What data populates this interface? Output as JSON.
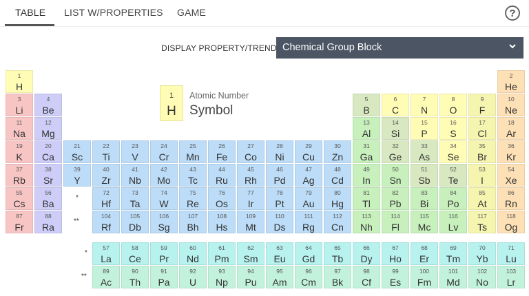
{
  "tabs": [
    {
      "label": "TABLE",
      "active": true
    },
    {
      "label": "LIST W/PROPERTIES",
      "active": false
    },
    {
      "label": "GAME",
      "active": false
    }
  ],
  "help_icon": "question-circle-icon",
  "display": {
    "label": "DISPLAY PROPERTY/TREND",
    "selected": "Chemical Group Block"
  },
  "legend": {
    "number": "1",
    "symbol": "H",
    "number_label": "Atomic Number",
    "symbol_label": "Symbol"
  },
  "markers": {
    "lanthanide": "*",
    "actinide": "**"
  },
  "colors": {
    "nonmetal": "#fffcb5",
    "noble_gas": "#fde0b5",
    "alkali_metal": "#f8c5c5",
    "alkaline_earth": "#cdcdf8",
    "transition_metal": "#bcdcf7",
    "post_transition": "#c7f0bd",
    "metalloid": "#d8e8c0",
    "halogen": "#f5f5b0",
    "lanthanide": "#b7f2ee",
    "actinide": "#c2f2dc"
  },
  "elements": [
    {
      "n": "1",
      "s": "H",
      "g": "nonmetal"
    },
    {
      "n": "2",
      "s": "He",
      "g": "noble_gas"
    },
    {
      "n": "3",
      "s": "Li",
      "g": "alkali_metal"
    },
    {
      "n": "4",
      "s": "Be",
      "g": "alkaline_earth"
    },
    {
      "n": "5",
      "s": "B",
      "g": "metalloid"
    },
    {
      "n": "6",
      "s": "C",
      "g": "nonmetal"
    },
    {
      "n": "7",
      "s": "N",
      "g": "nonmetal"
    },
    {
      "n": "8",
      "s": "O",
      "g": "nonmetal"
    },
    {
      "n": "9",
      "s": "F",
      "g": "halogen"
    },
    {
      "n": "10",
      "s": "Ne",
      "g": "noble_gas"
    },
    {
      "n": "11",
      "s": "Na",
      "g": "alkali_metal"
    },
    {
      "n": "12",
      "s": "Mg",
      "g": "alkaline_earth"
    },
    {
      "n": "13",
      "s": "Al",
      "g": "post_transition"
    },
    {
      "n": "14",
      "s": "Si",
      "g": "metalloid"
    },
    {
      "n": "15",
      "s": "P",
      "g": "nonmetal"
    },
    {
      "n": "16",
      "s": "S",
      "g": "nonmetal"
    },
    {
      "n": "17",
      "s": "Cl",
      "g": "halogen"
    },
    {
      "n": "18",
      "s": "Ar",
      "g": "noble_gas"
    },
    {
      "n": "19",
      "s": "K",
      "g": "alkali_metal"
    },
    {
      "n": "20",
      "s": "Ca",
      "g": "alkaline_earth"
    },
    {
      "n": "21",
      "s": "Sc",
      "g": "transition_metal"
    },
    {
      "n": "22",
      "s": "Ti",
      "g": "transition_metal"
    },
    {
      "n": "23",
      "s": "V",
      "g": "transition_metal"
    },
    {
      "n": "24",
      "s": "Cr",
      "g": "transition_metal"
    },
    {
      "n": "25",
      "s": "Mn",
      "g": "transition_metal"
    },
    {
      "n": "26",
      "s": "Fe",
      "g": "transition_metal"
    },
    {
      "n": "27",
      "s": "Co",
      "g": "transition_metal"
    },
    {
      "n": "28",
      "s": "Ni",
      "g": "transition_metal"
    },
    {
      "n": "29",
      "s": "Cu",
      "g": "transition_metal"
    },
    {
      "n": "30",
      "s": "Zn",
      "g": "transition_metal"
    },
    {
      "n": "31",
      "s": "Ga",
      "g": "post_transition"
    },
    {
      "n": "32",
      "s": "Ge",
      "g": "metalloid"
    },
    {
      "n": "33",
      "s": "As",
      "g": "metalloid"
    },
    {
      "n": "34",
      "s": "Se",
      "g": "nonmetal"
    },
    {
      "n": "35",
      "s": "Br",
      "g": "halogen"
    },
    {
      "n": "36",
      "s": "Kr",
      "g": "noble_gas"
    },
    {
      "n": "37",
      "s": "Rb",
      "g": "alkali_metal"
    },
    {
      "n": "38",
      "s": "Sr",
      "g": "alkaline_earth"
    },
    {
      "n": "39",
      "s": "Y",
      "g": "transition_metal"
    },
    {
      "n": "40",
      "s": "Zr",
      "g": "transition_metal"
    },
    {
      "n": "41",
      "s": "Nb",
      "g": "transition_metal"
    },
    {
      "n": "42",
      "s": "Mo",
      "g": "transition_metal"
    },
    {
      "n": "43",
      "s": "Tc",
      "g": "transition_metal"
    },
    {
      "n": "44",
      "s": "Ru",
      "g": "transition_metal"
    },
    {
      "n": "45",
      "s": "Rh",
      "g": "transition_metal"
    },
    {
      "n": "46",
      "s": "Pd",
      "g": "transition_metal"
    },
    {
      "n": "47",
      "s": "Ag",
      "g": "transition_metal"
    },
    {
      "n": "48",
      "s": "Cd",
      "g": "transition_metal"
    },
    {
      "n": "49",
      "s": "In",
      "g": "post_transition"
    },
    {
      "n": "50",
      "s": "Sn",
      "g": "post_transition"
    },
    {
      "n": "51",
      "s": "Sb",
      "g": "metalloid"
    },
    {
      "n": "52",
      "s": "Te",
      "g": "metalloid"
    },
    {
      "n": "53",
      "s": "I",
      "g": "halogen"
    },
    {
      "n": "54",
      "s": "Xe",
      "g": "noble_gas"
    },
    {
      "n": "55",
      "s": "Cs",
      "g": "alkali_metal"
    },
    {
      "n": "56",
      "s": "Ba",
      "g": "alkaline_earth"
    },
    {
      "n": "72",
      "s": "Hf",
      "g": "transition_metal"
    },
    {
      "n": "73",
      "s": "Ta",
      "g": "transition_metal"
    },
    {
      "n": "74",
      "s": "W",
      "g": "transition_metal"
    },
    {
      "n": "75",
      "s": "Re",
      "g": "transition_metal"
    },
    {
      "n": "76",
      "s": "Os",
      "g": "transition_metal"
    },
    {
      "n": "77",
      "s": "Ir",
      "g": "transition_metal"
    },
    {
      "n": "78",
      "s": "Pt",
      "g": "transition_metal"
    },
    {
      "n": "79",
      "s": "Au",
      "g": "transition_metal"
    },
    {
      "n": "80",
      "s": "Hg",
      "g": "transition_metal"
    },
    {
      "n": "81",
      "s": "Tl",
      "g": "post_transition"
    },
    {
      "n": "82",
      "s": "Pb",
      "g": "post_transition"
    },
    {
      "n": "83",
      "s": "Bi",
      "g": "post_transition"
    },
    {
      "n": "84",
      "s": "Po",
      "g": "post_transition"
    },
    {
      "n": "85",
      "s": "At",
      "g": "halogen"
    },
    {
      "n": "86",
      "s": "Rn",
      "g": "noble_gas"
    },
    {
      "n": "87",
      "s": "Fr",
      "g": "alkali_metal"
    },
    {
      "n": "88",
      "s": "Ra",
      "g": "alkaline_earth"
    },
    {
      "n": "104",
      "s": "Rf",
      "g": "transition_metal"
    },
    {
      "n": "105",
      "s": "Db",
      "g": "transition_metal"
    },
    {
      "n": "106",
      "s": "Sg",
      "g": "transition_metal"
    },
    {
      "n": "107",
      "s": "Bh",
      "g": "transition_metal"
    },
    {
      "n": "108",
      "s": "Hs",
      "g": "transition_metal"
    },
    {
      "n": "109",
      "s": "Mt",
      "g": "transition_metal"
    },
    {
      "n": "110",
      "s": "Ds",
      "g": "transition_metal"
    },
    {
      "n": "111",
      "s": "Rg",
      "g": "transition_metal"
    },
    {
      "n": "112",
      "s": "Cn",
      "g": "transition_metal"
    },
    {
      "n": "113",
      "s": "Nh",
      "g": "post_transition"
    },
    {
      "n": "114",
      "s": "Fl",
      "g": "post_transition"
    },
    {
      "n": "115",
      "s": "Mc",
      "g": "post_transition"
    },
    {
      "n": "116",
      "s": "Lv",
      "g": "post_transition"
    },
    {
      "n": "117",
      "s": "Ts",
      "g": "halogen"
    },
    {
      "n": "118",
      "s": "Og",
      "g": "noble_gas"
    },
    {
      "n": "57",
      "s": "La",
      "g": "lanthanide"
    },
    {
      "n": "58",
      "s": "Ce",
      "g": "lanthanide"
    },
    {
      "n": "59",
      "s": "Pr",
      "g": "lanthanide"
    },
    {
      "n": "60",
      "s": "Nd",
      "g": "lanthanide"
    },
    {
      "n": "61",
      "s": "Pm",
      "g": "lanthanide"
    },
    {
      "n": "62",
      "s": "Sm",
      "g": "lanthanide"
    },
    {
      "n": "63",
      "s": "Eu",
      "g": "lanthanide"
    },
    {
      "n": "64",
      "s": "Gd",
      "g": "lanthanide"
    },
    {
      "n": "65",
      "s": "Tb",
      "g": "lanthanide"
    },
    {
      "n": "66",
      "s": "Dy",
      "g": "lanthanide"
    },
    {
      "n": "67",
      "s": "Ho",
      "g": "lanthanide"
    },
    {
      "n": "68",
      "s": "Er",
      "g": "lanthanide"
    },
    {
      "n": "69",
      "s": "Tm",
      "g": "lanthanide"
    },
    {
      "n": "70",
      "s": "Yb",
      "g": "lanthanide"
    },
    {
      "n": "71",
      "s": "Lu",
      "g": "lanthanide"
    },
    {
      "n": "89",
      "s": "Ac",
      "g": "actinide"
    },
    {
      "n": "90",
      "s": "Th",
      "g": "actinide"
    },
    {
      "n": "91",
      "s": "Pa",
      "g": "actinide"
    },
    {
      "n": "92",
      "s": "U",
      "g": "actinide"
    },
    {
      "n": "93",
      "s": "Np",
      "g": "actinide"
    },
    {
      "n": "94",
      "s": "Pu",
      "g": "actinide"
    },
    {
      "n": "95",
      "s": "Am",
      "g": "actinide"
    },
    {
      "n": "96",
      "s": "Cm",
      "g": "actinide"
    },
    {
      "n": "97",
      "s": "Bk",
      "g": "actinide"
    },
    {
      "n": "98",
      "s": "Cf",
      "g": "actinide"
    },
    {
      "n": "99",
      "s": "Es",
      "g": "actinide"
    },
    {
      "n": "100",
      "s": "Fm",
      "g": "actinide"
    },
    {
      "n": "101",
      "s": "Md",
      "g": "actinide"
    },
    {
      "n": "102",
      "s": "No",
      "g": "actinide"
    },
    {
      "n": "103",
      "s": "Lr",
      "g": "actinide"
    }
  ]
}
